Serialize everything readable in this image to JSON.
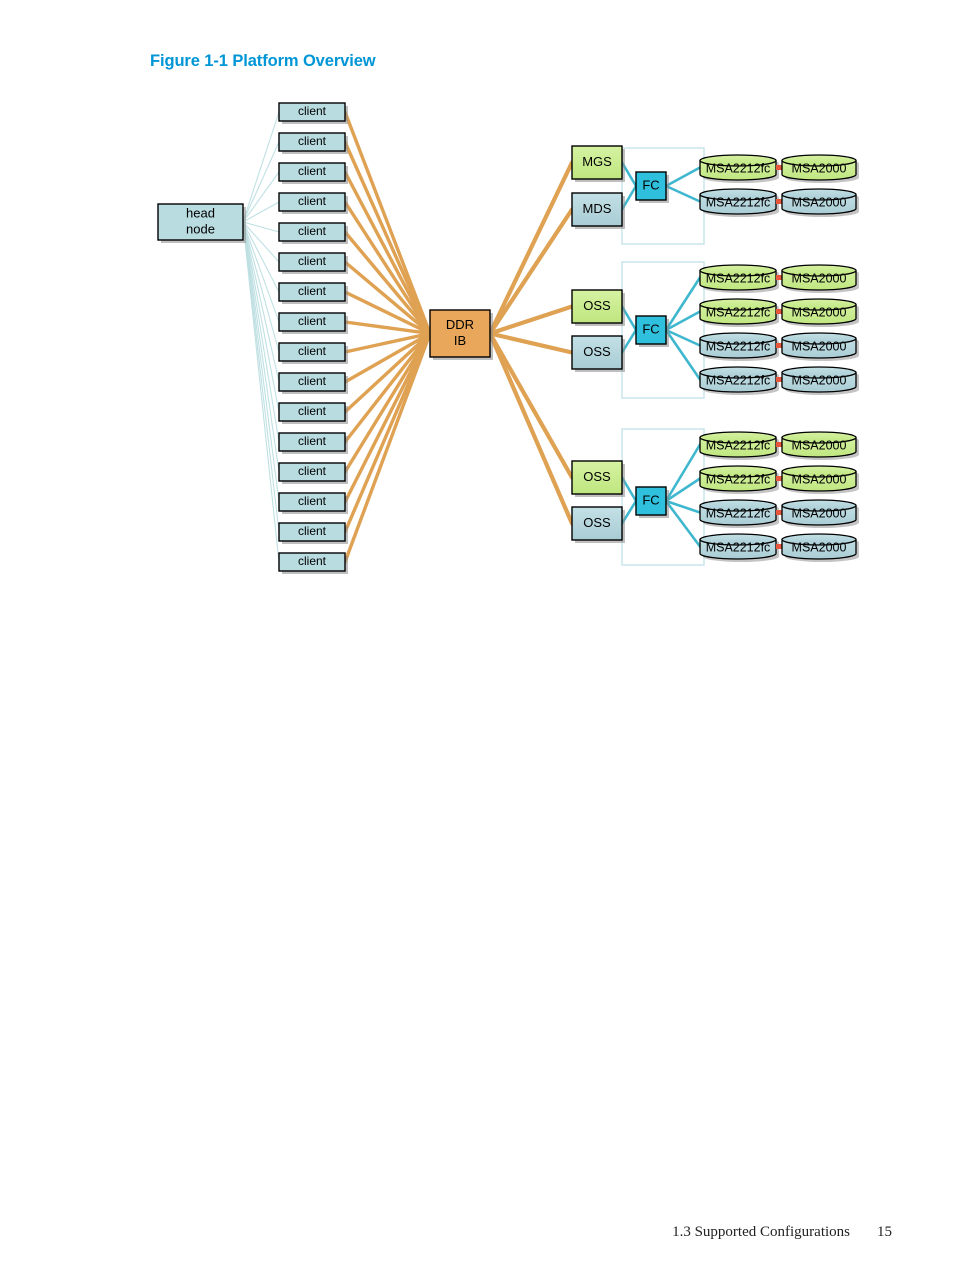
{
  "figure": {
    "title": "Figure 1-1 Platform Overview"
  },
  "footer": {
    "section": "1.3 Supported Configurations",
    "page": "15"
  },
  "colors": {
    "title_blue": "#0096d6",
    "client_fill": "#b9dce1",
    "head_node_fill": "#b9dce1",
    "ddr_ib_fill": "#e3a košer",
    "ddr_fill": "#e8a75a",
    "green_fill": "#cdee93",
    "blue_fill": "#b5d8de",
    "fc_fill": "#2fc0dd",
    "link_orange": "#dfa152",
    "link_cyan": "#3fb8cf",
    "link_faint": "#bfe0e3",
    "connector_red": "#e8563c",
    "frame_cyan": "#c5e4ea",
    "stroke_black": "#000000",
    "shadow_gray": "#8a8a8a"
  },
  "diagram": {
    "head_node": {
      "label_line1": "head",
      "label_line2": "node"
    },
    "fabric": {
      "label_line1": "DDR",
      "label_line2": "IB"
    },
    "client_label": "client",
    "client_count": 16,
    "servers": [
      {
        "label": "MGS",
        "color": "green"
      },
      {
        "label": "MDS",
        "color": "blue"
      },
      {
        "label": "OSS",
        "color": "green"
      },
      {
        "label": "OSS",
        "color": "blue"
      },
      {
        "label": "OSS",
        "color": "green"
      },
      {
        "label": "OSS",
        "color": "blue"
      }
    ],
    "switch_label": "FC",
    "switch_count": 3,
    "storage_groups": [
      {
        "rows": [
          {
            "controller": "MSA2212fc",
            "enclosure": "MSA2000",
            "color": "green"
          },
          {
            "controller": "MSA2212fc",
            "enclosure": "MSA2000",
            "color": "blue"
          }
        ]
      },
      {
        "rows": [
          {
            "controller": "MSA2212fc",
            "enclosure": "MSA2000",
            "color": "green"
          },
          {
            "controller": "MSA2212fc",
            "enclosure": "MSA2000",
            "color": "green"
          },
          {
            "controller": "MSA2212fc",
            "enclosure": "MSA2000",
            "color": "blue"
          },
          {
            "controller": "MSA2212fc",
            "enclosure": "MSA2000",
            "color": "blue"
          }
        ]
      },
      {
        "rows": [
          {
            "controller": "MSA2212fc",
            "enclosure": "MSA2000",
            "color": "green"
          },
          {
            "controller": "MSA2212fc",
            "enclosure": "MSA2000",
            "color": "green"
          },
          {
            "controller": "MSA2212fc",
            "enclosure": "MSA2000",
            "color": "blue"
          },
          {
            "controller": "MSA2212fc",
            "enclosure": "MSA2000",
            "color": "blue"
          }
        ]
      }
    ]
  }
}
